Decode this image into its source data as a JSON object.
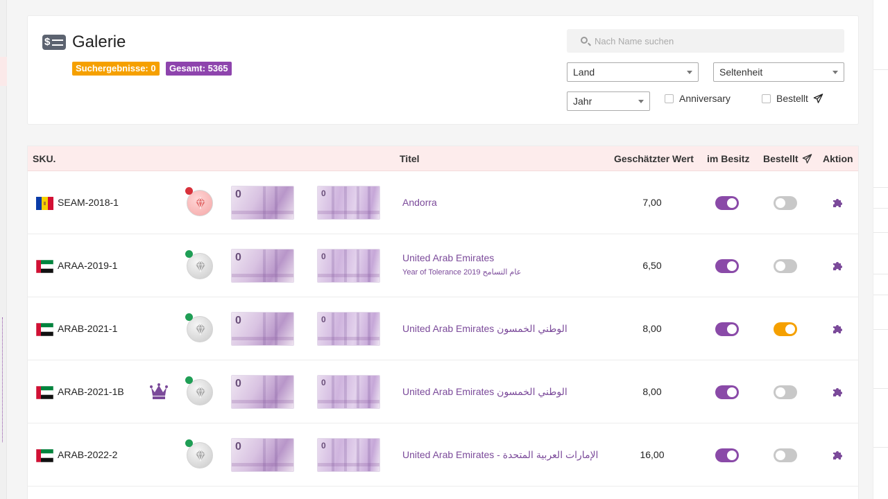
{
  "header": {
    "title": "Galerie",
    "badges": {
      "results": "Suchergebnisse: 0",
      "total": "Gesamt: 5365"
    },
    "search": {
      "placeholder": "Nach Name suchen"
    },
    "filters": {
      "country": "Land",
      "rarity": "Seltenheit",
      "year": "Jahr",
      "anniversary": "Anniversary",
      "ordered": "Bestellt"
    }
  },
  "colors": {
    "accent_purple": "#8e44ad",
    "accent_orange": "#f5a000",
    "toggle_on_purple": "#8a4aa8",
    "toggle_on_orange": "#f5a000",
    "toggle_off": "#c8c8c8",
    "header_row_bg": "#fdecec"
  },
  "table": {
    "columns": {
      "sku": "SKU.",
      "title": "Titel",
      "value": "Geschätzter Wert",
      "owned": "im Besitz",
      "ordered": "Bestellt",
      "action": "Aktion"
    },
    "rows": [
      {
        "flag": "andorra",
        "sku": "SEAM-2018-1",
        "crown": false,
        "coin_icon": "diamond-icon",
        "coin_status": "red",
        "title": "Andorra",
        "subtitle": "",
        "value": "7,00",
        "owned": true,
        "ordered": false
      },
      {
        "flag": "uae",
        "sku": "ARAA-2019-1",
        "crown": false,
        "coin_icon": "diamond-icon",
        "coin_status": "green",
        "title": "United Arab Emirates",
        "subtitle": "Year of Tolerance 2019 عام التسامح",
        "value": "6,50",
        "owned": true,
        "ordered": false
      },
      {
        "flag": "uae",
        "sku": "ARAB-2021-1",
        "crown": false,
        "coin_icon": "diamond-icon",
        "coin_status": "green",
        "title": "United Arab Emirates الوطني الخمسون",
        "subtitle": "",
        "value": "8,00",
        "owned": true,
        "ordered": true
      },
      {
        "flag": "uae",
        "sku": "ARAB-2021-1B",
        "crown": true,
        "coin_icon": "diamond-icon",
        "coin_status": "green",
        "title": "United Arab Emirates الوطني الخمسون",
        "subtitle": "",
        "value": "8,00",
        "owned": true,
        "ordered": false
      },
      {
        "flag": "uae",
        "sku": "ARAB-2022-2",
        "crown": false,
        "coin_icon": "diamond-icon",
        "coin_status": "green",
        "title": "United Arab Emirates - الإمارات العربية المتحدة",
        "subtitle": "",
        "value": "16,00",
        "owned": true,
        "ordered": false
      }
    ]
  }
}
